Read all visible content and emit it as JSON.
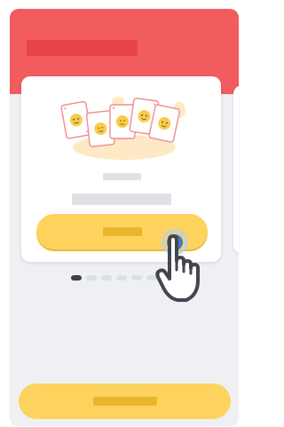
{
  "colors": {
    "header": "#f25c5f",
    "header_title_placeholder": "#e8434b",
    "screen_background": "#eef0f3",
    "card_background": "#ffffff",
    "text_placeholder": "#dfe1e6",
    "button_primary": "#fdd35e",
    "button_label_placeholder": "#e8b52d",
    "dot_active": "#3e4046",
    "dot_inactive": "#dcdfe4",
    "tap_indicator": "#3a7bd5"
  },
  "header": {
    "title_icon": "text-placeholder"
  },
  "card": {
    "illustration_icon": "emoji-face-cards-illustration",
    "title_icon": "text-placeholder",
    "subtitle_icon": "text-placeholder",
    "button_icon": "text-placeholder"
  },
  "pagination": {
    "dot_count": 8,
    "active_index": 0
  },
  "footer": {
    "button_icon": "text-placeholder"
  },
  "overlay": {
    "icon": "pointing-hand-tap-icon"
  }
}
